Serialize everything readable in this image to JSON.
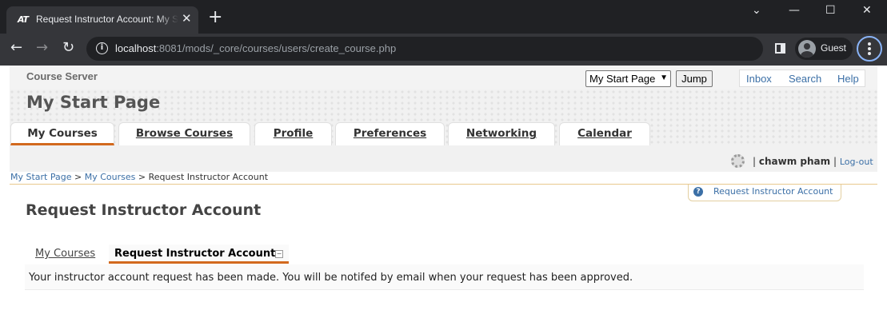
{
  "browser": {
    "favicon_text": "AT",
    "tab_title": "Request Instructor Account: My Start Page",
    "tab_close": "✕",
    "new_tab": "+",
    "window_controls": {
      "minimize": "—",
      "maximize": "☐",
      "close": "✕",
      "dropdown": "⌄"
    },
    "nav": {
      "back": "←",
      "forward": "→",
      "reload": "↻"
    },
    "url_host": "localhost",
    "url_rest": ":8081/mods/_core/courses/users/create_course.php",
    "profile_label": "Guest"
  },
  "topbar": {
    "site_name": "Course Server",
    "jump_select_value": "My Start Page",
    "jump_button": "Jump",
    "links": [
      "Inbox",
      "Search",
      "Help"
    ]
  },
  "header": {
    "title": "My Start Page",
    "tabs": [
      {
        "label": "My Courses",
        "active": true
      },
      {
        "label": "Browse Courses",
        "active": false
      },
      {
        "label": "Profile",
        "active": false
      },
      {
        "label": "Preferences",
        "active": false
      },
      {
        "label": "Networking",
        "active": false
      },
      {
        "label": "Calendar",
        "active": false
      }
    ],
    "user_separator": "|",
    "username": "chawm pham",
    "logout": "Log-out"
  },
  "breadcrumb": {
    "items": [
      "My Start Page",
      "My Courses"
    ],
    "separator": ">",
    "current": "Request Instructor Account"
  },
  "help": {
    "label": "Request Instructor Account",
    "icon": "?"
  },
  "content": {
    "heading": "Request Instructor Account",
    "subtabs": [
      {
        "label": "My Courses",
        "active": false
      },
      {
        "label": "Request Instructor Account",
        "active": true
      }
    ],
    "collapse_symbol": "−",
    "message": "Your instructor account request has been made. You will be notifed by email when your request has been approved."
  },
  "colors": {
    "chrome_dark": "#202124",
    "chrome_toolbar": "#35363a",
    "accent_orange": "#d2691e",
    "link_blue": "#3b6fa6"
  }
}
